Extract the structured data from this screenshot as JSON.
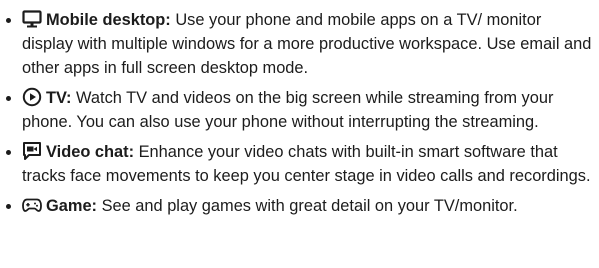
{
  "features": [
    {
      "icon": "desktop-monitor-icon",
      "title": "Mobile desktop:",
      "text": " Use your phone and mobile apps on a TV/ monitor display with multiple windows for a more productive workspace. Use email and other apps in full screen desktop mode."
    },
    {
      "icon": "play-circle-icon",
      "title": "TV:",
      "text": " Watch TV and videos on the big screen while streaming from your phone. You can also use your phone without interrupting the streaming."
    },
    {
      "icon": "video-chat-icon",
      "title": "Video chat:",
      "text": " Enhance your video chats with built-in smart software that tracks face movements to keep you center stage in video calls and recordings."
    },
    {
      "icon": "gamepad-icon",
      "title": "Game:",
      "text": " See and play games with great detail on your TV/monitor."
    }
  ]
}
